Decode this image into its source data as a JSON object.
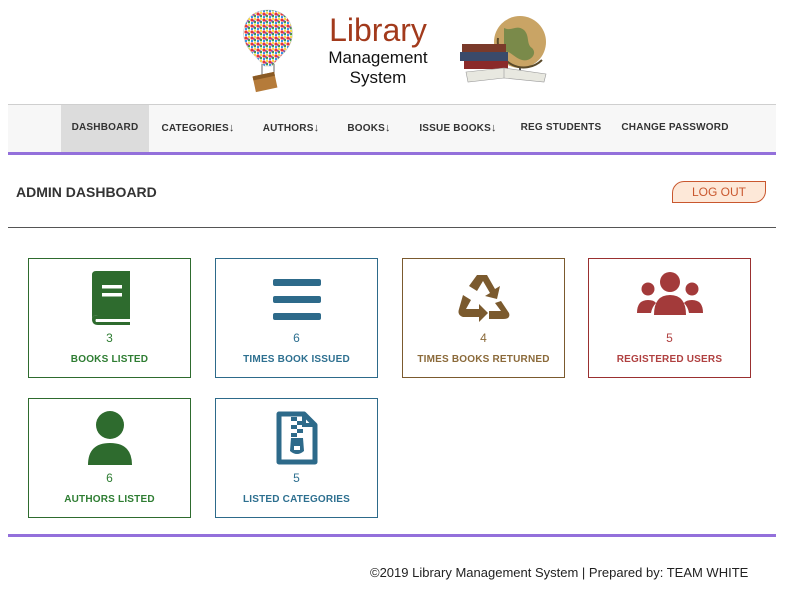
{
  "logo": {
    "title": "Library",
    "subtitle_line1": "Management",
    "subtitle_line2": "System"
  },
  "nav": {
    "items": [
      {
        "label": "DASHBOARD",
        "arrow": ""
      },
      {
        "label": "CATEGORIES",
        "arrow": "↓"
      },
      {
        "label": "AUTHORS",
        "arrow": "↓"
      },
      {
        "label": "BOOKS",
        "arrow": "↓"
      },
      {
        "label": "ISSUE BOOKS",
        "arrow": "↓"
      },
      {
        "label": "REG STUDENTS",
        "arrow": ""
      },
      {
        "label": "CHANGE PASSWORD",
        "arrow": ""
      }
    ],
    "active": "DASHBOARD"
  },
  "page": {
    "title": "ADMIN DASHBOARD",
    "logout_label": "LOG OUT"
  },
  "cards": [
    {
      "icon": "book-icon",
      "count": "3",
      "label": "BOOKS LISTED",
      "color": "#2e6b2e"
    },
    {
      "icon": "bars-icon",
      "count": "6",
      "label": "TIMES BOOK ISSUED",
      "color": "#2d6a8a"
    },
    {
      "icon": "recycle-icon",
      "count": "4",
      "label": "TIMES BOOKS RETURNED",
      "color": "#7b5a2e"
    },
    {
      "icon": "users-icon",
      "count": "5",
      "label": "REGISTERED USERS",
      "color": "#a33a3a"
    },
    {
      "icon": "user-icon",
      "count": "6",
      "label": "AUTHORS LISTED",
      "color": "#2e6b2e"
    },
    {
      "icon": "file-archive-icon",
      "count": "5",
      "label": "LISTED CATEGORIES",
      "color": "#2d6a8a"
    }
  ],
  "footer": {
    "text": "©2019 Library Management System | Prepared by: TEAM WHITE"
  }
}
